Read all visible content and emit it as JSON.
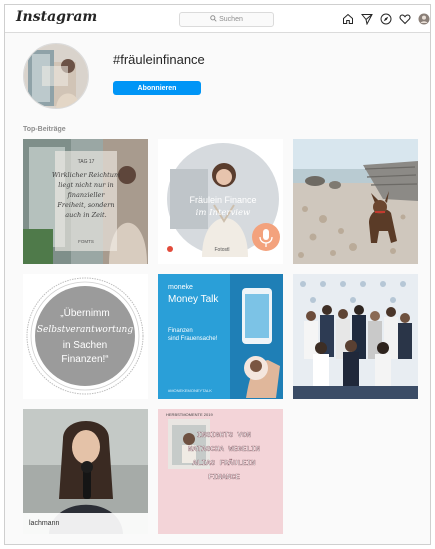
{
  "app": {
    "logo": "Instagram"
  },
  "search": {
    "placeholder": "Suchen"
  },
  "nav_icons": [
    "home-icon",
    "direct-icon",
    "explore-icon",
    "heart-icon",
    "profile-icon"
  ],
  "hashtag": {
    "title": "#fräuleinfinance",
    "follow_label": "Abonnieren"
  },
  "section": {
    "label": "Top-Beiträge"
  },
  "posts": [
    {
      "name": "post-quote-window",
      "lines": [
        "TAG 17",
        "Wirklicher Reichtum",
        "liegt nicht nur in",
        "finanzieller",
        "Freiheit, sondern",
        "auch in Zeit."
      ],
      "footer": "FOMTS"
    },
    {
      "name": "post-interview",
      "line1": "Fräulein Finance",
      "line2": "im Interview",
      "footer": "Fotostl"
    },
    {
      "name": "post-dog-beach"
    },
    {
      "name": "post-quote-circle",
      "lines": [
        "„Übernimm",
        "Selbstverantwortung",
        "in Sachen",
        "Finanzen!“"
      ]
    },
    {
      "name": "post-money-talk",
      "brand": "moneke",
      "title": "Money Talk",
      "subtitle_lines": [
        "Finanzen",
        "sind Frauensache!"
      ],
      "footer": "#MONEKEMONEYTALK"
    },
    {
      "name": "post-group-photo"
    },
    {
      "name": "post-woman-microphone",
      "caption": "lachmann"
    },
    {
      "name": "post-insights",
      "header": "HERBSTMOMENTE 2019",
      "lines": [
        "INSIGHTS VON",
        "NATASCHA WEGELIN",
        "ALIAS FRÄULEIN",
        "FINANCE"
      ]
    }
  ],
  "colors": {
    "accent": "#0095f6",
    "border": "#dbdbdb",
    "background": "#fafafa",
    "secondary_text": "#8e8e8e",
    "money_talk_blue": "#2a9fd8",
    "insights_pink": "#f3d4d8"
  }
}
